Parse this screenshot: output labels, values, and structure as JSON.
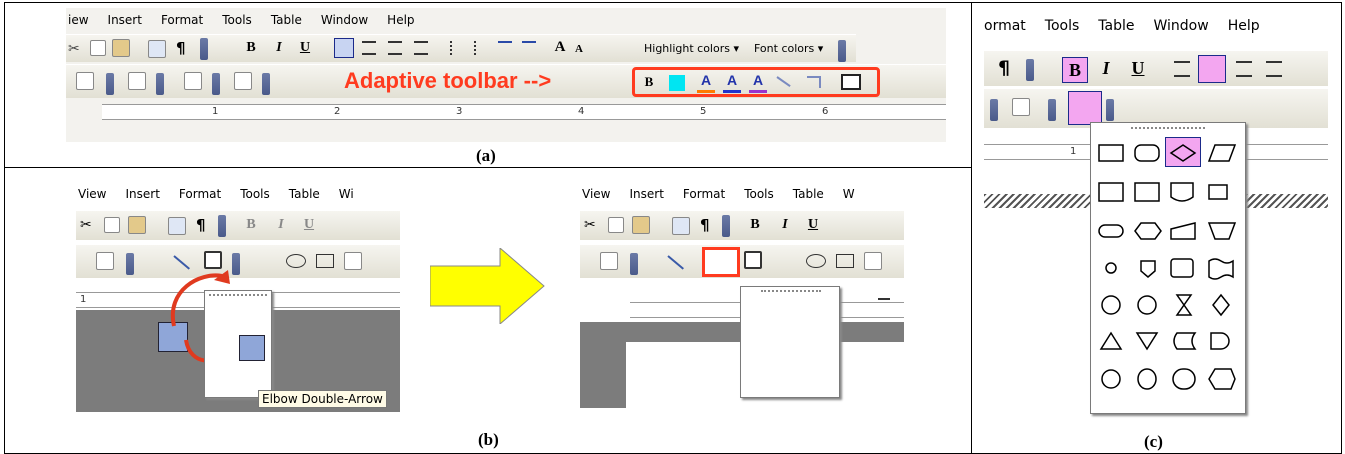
{
  "panel_a": {
    "caption": "(a)",
    "menu": [
      "iew",
      "Insert",
      "Format",
      "Tools",
      "Table",
      "Window",
      "Help"
    ],
    "toolbar_tail": [
      "Highlight colors ▾",
      "Font colors ▾"
    ],
    "annotation": "Adaptive toolbar -->",
    "annotation_color": "#ff3b1f",
    "ruler_numbers": [
      "1",
      "2",
      "3",
      "4",
      "5",
      "6"
    ]
  },
  "panel_b": {
    "caption": "(b)",
    "menu_left": [
      "View",
      "Insert",
      "Format",
      "Tools",
      "Table",
      "Wi"
    ],
    "menu_right": [
      "View",
      "Insert",
      "Format",
      "Tools",
      "Table",
      "W"
    ],
    "ruler_number": "1",
    "tooltip": "Elbow Double-Arrow",
    "arrow_color": "#ffff00"
  },
  "panel_c": {
    "caption": "(c)",
    "menu": [
      "ormat",
      "Tools",
      "Table",
      "Window",
      "Help"
    ],
    "ruler_number": "1",
    "selected_color": "#f3a6f0"
  },
  "toolbar_glyphs": {
    "bold": "B",
    "italic": "I",
    "underline": "U",
    "pilcrow": "¶",
    "font_a": "A"
  }
}
